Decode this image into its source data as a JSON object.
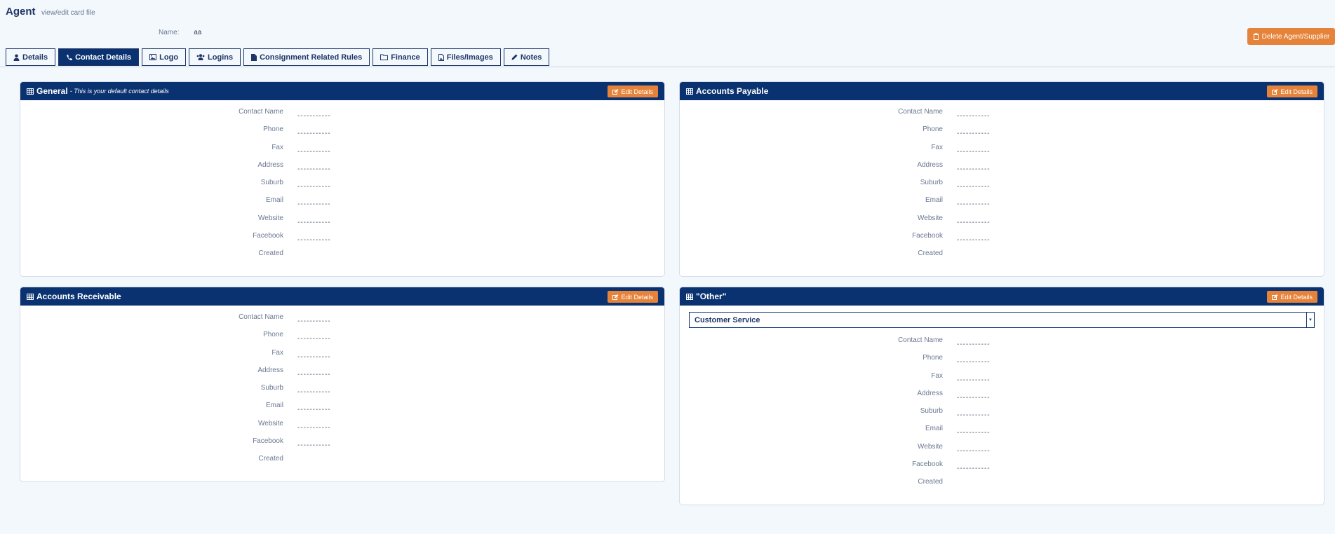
{
  "header": {
    "title": "Agent",
    "subtitle": "view/edit card file",
    "name_label": "Name:",
    "name_value": "aa",
    "delete_label": "Delete Agent/Supplier"
  },
  "tabs": [
    {
      "label": "Details",
      "icon": "user-icon"
    },
    {
      "label": "Contact Details",
      "icon": "phone-icon"
    },
    {
      "label": "Logo",
      "icon": "image-icon"
    },
    {
      "label": "Logins",
      "icon": "users-icon"
    },
    {
      "label": "Consignment Related Rules",
      "icon": "file-icon"
    },
    {
      "label": "Finance",
      "icon": "folder-icon"
    },
    {
      "label": "Files/Images",
      "icon": "file-image-icon"
    },
    {
      "label": "Notes",
      "icon": "pencil-icon"
    }
  ],
  "field_labels": [
    "Contact Name",
    "Phone",
    "Fax",
    "Address",
    "Suburb",
    "Email",
    "Website",
    "Facebook",
    "Created"
  ],
  "placeholder": "-----------",
  "edit_label": "Edit Details",
  "panels": {
    "general": {
      "title": "General",
      "note": "- This is your default contact details"
    },
    "payable": {
      "title": "Accounts Payable"
    },
    "receivable": {
      "title": "Accounts Receivable"
    },
    "other": {
      "title": "\"Other\"",
      "selected": "Customer Service"
    }
  },
  "colors": {
    "navy": "#0b3270",
    "orange": "#e6833a",
    "background": "#f3f8fd"
  }
}
